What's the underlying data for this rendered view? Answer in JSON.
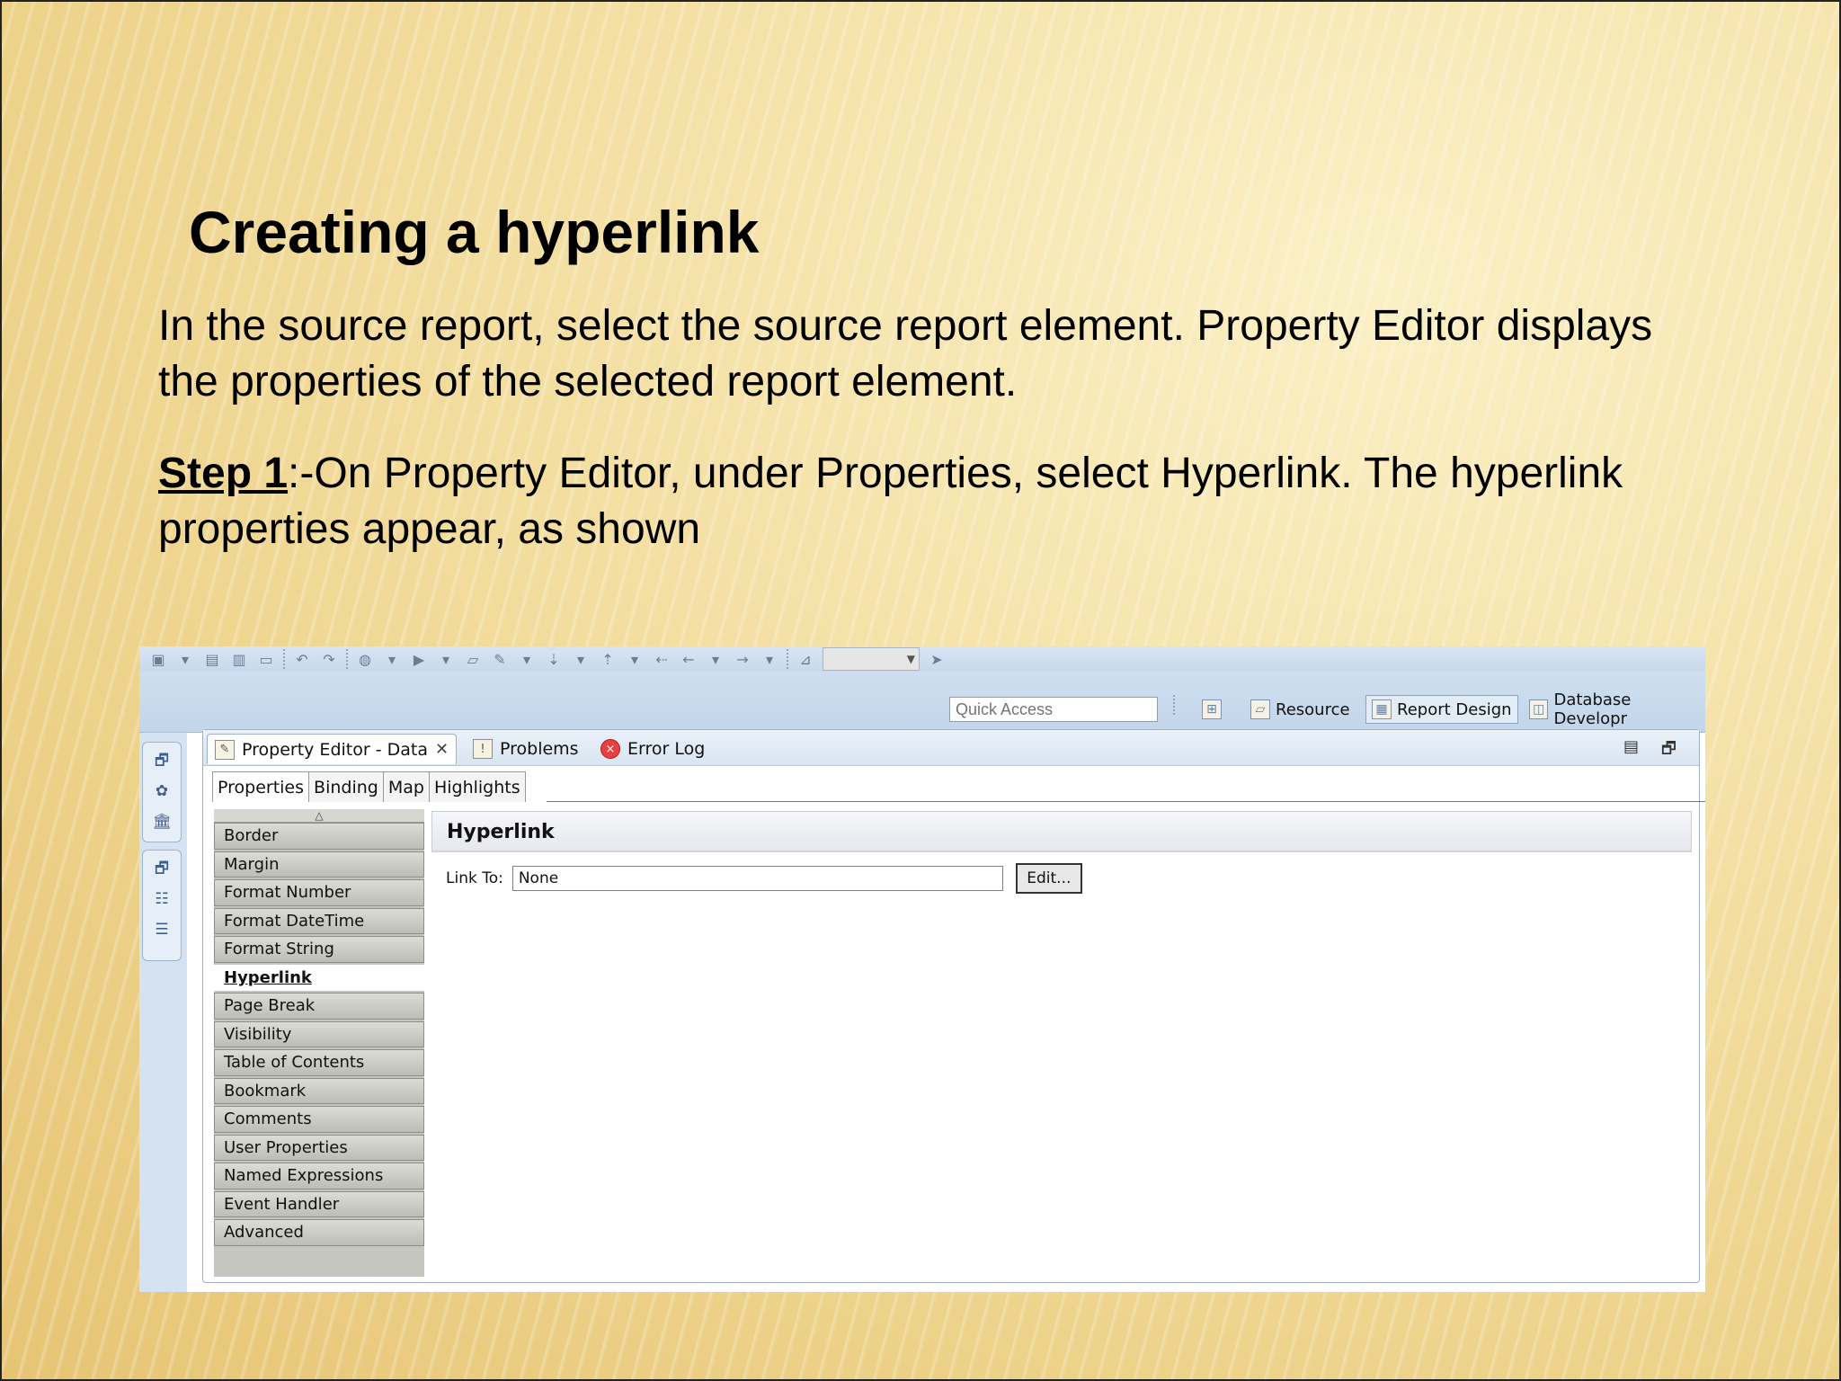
{
  "slide": {
    "title": "Creating a hyperlink",
    "para1": "In the source report, select the source report element. Property Editor displays the properties of the selected report element.",
    "step_label": "Step 1",
    "step_text": ":-On Property Editor, under Properties, select Hyperlink. The hyperlink properties appear, as shown"
  },
  "toolbar": {
    "quick_access_placeholder": "Quick Access",
    "perspectives": [
      "Resource",
      "Report Design",
      "Database Developr"
    ],
    "active_perspective": "Report Design"
  },
  "editor": {
    "tabs": [
      {
        "label": "Property Editor - Data",
        "active": true
      },
      {
        "label": "Problems",
        "active": false
      },
      {
        "label": "Error Log",
        "active": false
      }
    ],
    "subtabs": [
      "Properties",
      "Binding",
      "Map",
      "Highlights"
    ],
    "categories": [
      "Border",
      "Margin",
      "Format Number",
      "Format DateTime",
      "Format String",
      "Hyperlink",
      "Page Break",
      "Visibility",
      "Table of Contents",
      "Bookmark",
      "Comments",
      "User Properties",
      "Named Expressions",
      "Event Handler",
      "Advanced"
    ],
    "selected_category": "Hyperlink",
    "section_title": "Hyperlink",
    "link_to_label": "Link To:",
    "link_to_value": "None",
    "edit_button": "Edit..."
  }
}
